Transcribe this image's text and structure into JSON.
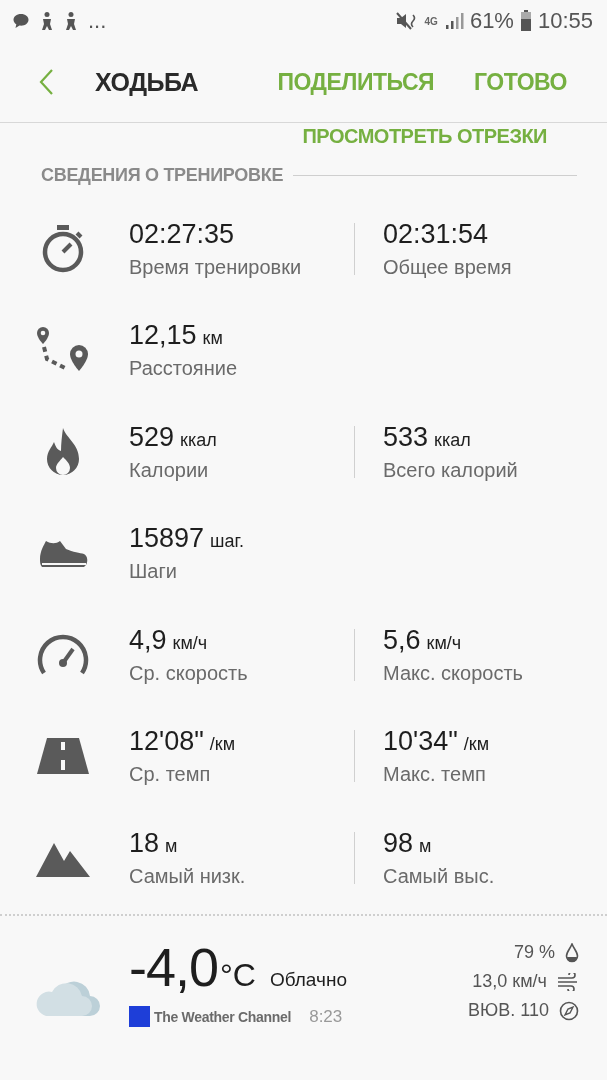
{
  "status_bar": {
    "overflow": "...",
    "network": "4G",
    "battery": "61%",
    "time": "10:55"
  },
  "header": {
    "title": "ХОДЬБА",
    "actions": [
      "ПОДЕЛИТЬСЯ",
      "ГОТОВО"
    ]
  },
  "segments_link": "ПРОСМОТРЕТЬ ОТРЕЗКИ",
  "section_title": "СВЕДЕНИЯ О ТРЕНИРОВКЕ",
  "stats": [
    {
      "kind": "stopwatch",
      "left": {
        "value": "02:27:35",
        "label": "Время тренировки"
      },
      "right": {
        "value": "02:31:54",
        "label": "Общее время"
      }
    },
    {
      "kind": "route",
      "left": {
        "value": "12,15",
        "unit": "км",
        "label": "Расстояние"
      }
    },
    {
      "kind": "flame",
      "left": {
        "value": "529",
        "unit": "ккал",
        "label": "Калории"
      },
      "right": {
        "value": "533",
        "unit": "ккал",
        "label": "Всего калорий"
      }
    },
    {
      "kind": "shoe",
      "left": {
        "value": "15897",
        "unit": "шаг.",
        "label": "Шаги"
      }
    },
    {
      "kind": "speedometer",
      "left": {
        "value": "4,9",
        "unit": "км/ч",
        "label": "Ср. скорость"
      },
      "right": {
        "value": "5,6",
        "unit": "км/ч",
        "label": "Макс. скорость"
      }
    },
    {
      "kind": "road",
      "left": {
        "value": "12'08\"",
        "unit": "/км",
        "label": "Ср. темп"
      },
      "right": {
        "value": "10'34\"",
        "unit": "/км",
        "label": "Макс. темп"
      }
    },
    {
      "kind": "mountain",
      "left": {
        "value": "18",
        "unit": "м",
        "label": "Самый низк."
      },
      "right": {
        "value": "98",
        "unit": "м",
        "label": "Самый выс."
      }
    }
  ],
  "weather": {
    "temperature": "-4,0",
    "temperature_unit": "°C",
    "condition": "Облачно",
    "source": "The Weather Channel",
    "updated": "8:23",
    "humidity": "79 %",
    "wind_speed": "13,0 км/ч",
    "wind_direction": "ВЮВ. 110"
  }
}
